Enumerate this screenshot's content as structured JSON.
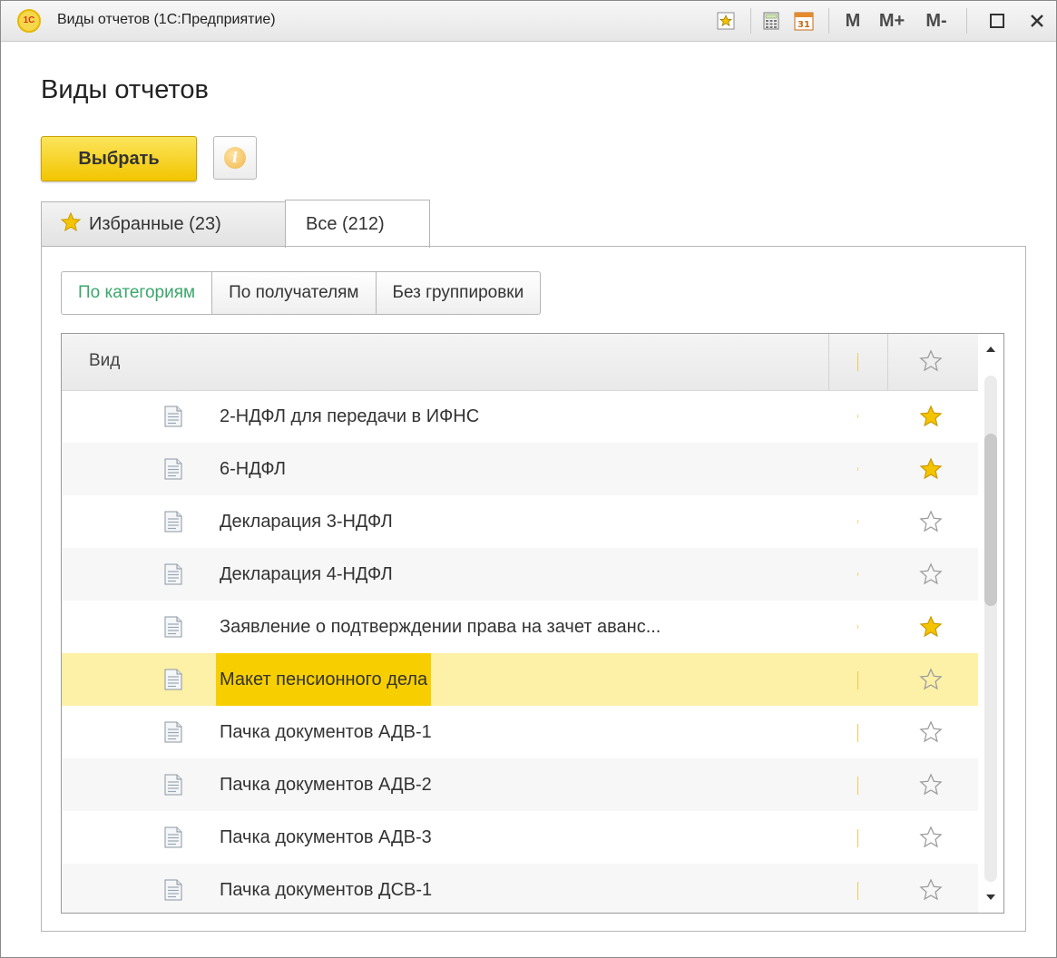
{
  "window": {
    "title": "Виды отчетов  (1С:Предприятие)",
    "logo_text": "1С",
    "toolbar": {
      "memory": "M",
      "memory_plus": "M+",
      "memory_minus": "M-",
      "calendar_day": "31",
      "maximize_icon": "maximize-icon",
      "close_icon": "close-icon"
    }
  },
  "page": {
    "title": "Виды отчетов",
    "select_button": "Выбрать",
    "info_glyph": "i"
  },
  "tabs": [
    {
      "label": "Избранные (23)",
      "icon": "star-icon",
      "active": false
    },
    {
      "label": "Все (212)",
      "active": true
    }
  ],
  "grouping": [
    {
      "label": "По категориям",
      "active": true
    },
    {
      "label": "По получателям",
      "active": false
    },
    {
      "label": "Без группировки",
      "active": false
    }
  ],
  "table": {
    "columns": [
      "Вид",
      "",
      "favorite"
    ],
    "rows": [
      {
        "name": "2-НДФЛ для передачи в ИФНС",
        "favorite": true
      },
      {
        "name": "6-НДФЛ",
        "favorite": true
      },
      {
        "name": "Декларация 3-НДФЛ",
        "favorite": false
      },
      {
        "name": "Декларация 4-НДФЛ",
        "favorite": false
      },
      {
        "name": "Заявление о подтверждении права на зачет аванс...",
        "favorite": true
      },
      {
        "name": "Макет пенсионного дела",
        "favorite": false,
        "selected": true
      },
      {
        "name": "Пачка документов АДВ-1",
        "favorite": false
      },
      {
        "name": "Пачка документов АДВ-2",
        "favorite": false
      },
      {
        "name": "Пачка документов АДВ-3",
        "favorite": false
      },
      {
        "name": "Пачка документов ДСВ-1",
        "favorite": false
      }
    ]
  },
  "colors": {
    "accent_yellow": "#f2c500",
    "selected_row": "#fdf0a7",
    "active_group_text": "#3aa76b",
    "star_filled": "#f5c400"
  }
}
